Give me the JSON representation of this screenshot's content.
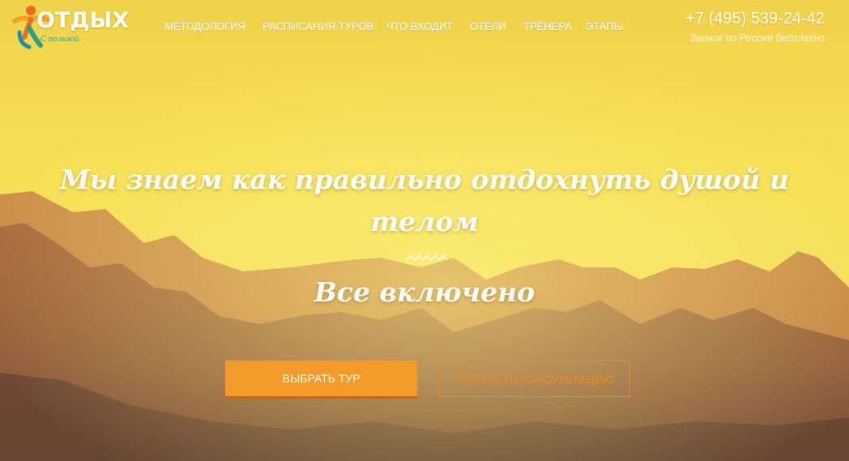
{
  "logo": {
    "main": "ОТДЫХ",
    "sub": "С пользой",
    "icon": "person-figure-icon"
  },
  "nav": {
    "items": [
      {
        "label": "Методология"
      },
      {
        "label": "Расписания туров"
      },
      {
        "label": "Что входит"
      },
      {
        "label": "Отели"
      },
      {
        "label": "Тренера"
      },
      {
        "label": "Этапы"
      }
    ]
  },
  "contact": {
    "phone": "+7 (495) 539-24-42",
    "note": "Звонок по России бесплатно"
  },
  "hero": {
    "headline": "Мы знаем как правильно отдохнуть душой и телом",
    "subheadline": "Все включено",
    "divider_icon": "zigzag-divider-icon"
  },
  "buttons": {
    "primary": "Выбрать тур",
    "secondary": "Получить консультацию"
  },
  "colors": {
    "sky": "#f6e24e",
    "sky_top": "#f2d84a",
    "mountains": "#b0683a",
    "accent": "#f29b2a",
    "accent_dark": "#d0621c",
    "outline": "#f08a1a"
  }
}
